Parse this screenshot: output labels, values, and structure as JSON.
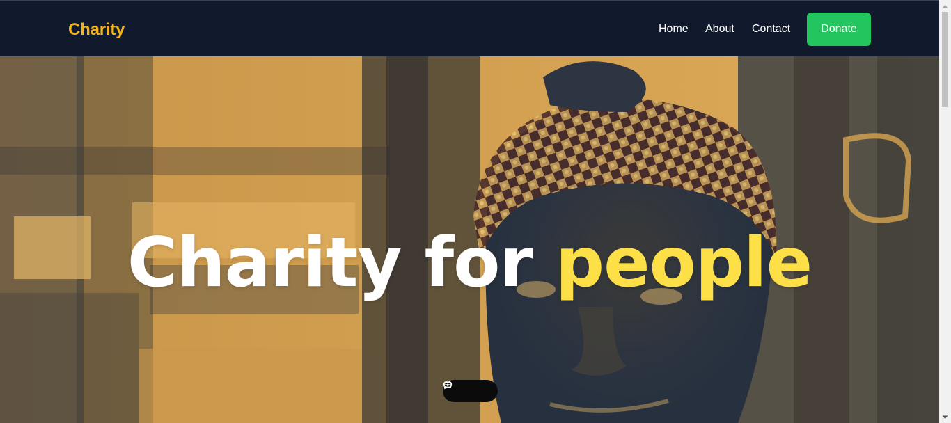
{
  "header": {
    "brand": "Charity",
    "nav": [
      "Home",
      "About",
      "Contact"
    ],
    "donate_label": "Donate"
  },
  "hero": {
    "title_main": "Charity for",
    "title_accent": "people"
  },
  "floating_toolbar": {
    "icons": [
      "chat-icon",
      "eye-icon",
      "menu-icon"
    ]
  },
  "colors": {
    "header_bg": "#111a2d",
    "brand": "#f4b416",
    "donate_bg": "#22c55e",
    "accent_text": "#fde047",
    "hero_tint": "#d6a451"
  }
}
